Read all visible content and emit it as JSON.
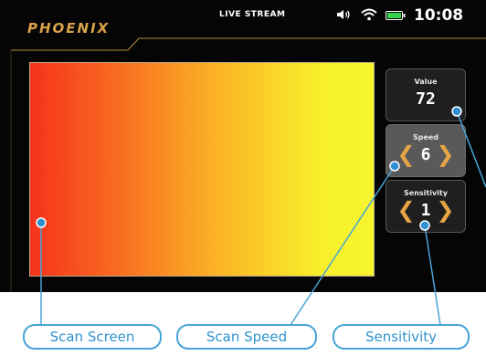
{
  "header": {
    "logo": "PHOENIX",
    "title": "LIVE STREAM",
    "time": "10:08",
    "icons": [
      "speaker-icon",
      "wifi-icon",
      "battery-icon"
    ]
  },
  "panels": {
    "value": {
      "label": "Value",
      "value": "72"
    },
    "speed": {
      "label": "Speed",
      "value": "6"
    },
    "sensitivity": {
      "label": "Sensitivity",
      "value": "1"
    }
  },
  "callouts": {
    "scan_screen": "Scan Screen",
    "scan_speed": "Scan Speed",
    "sensitivity": "Sensitivity"
  },
  "colors": {
    "accent": "#e7a444",
    "callout": "#48a3d6",
    "gradient_start": "#f5331c",
    "gradient_end": "#f5f52e"
  }
}
